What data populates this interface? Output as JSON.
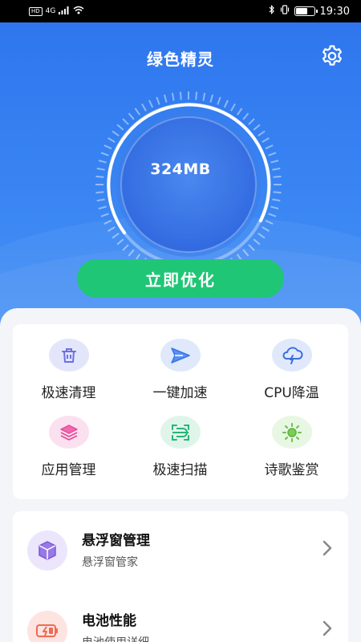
{
  "status_bar": {
    "network": "4G",
    "hd": "HD",
    "time": "19:30",
    "battery_level": 0.6
  },
  "header": {
    "title": "绿色精灵",
    "settings_icon": "gear-icon"
  },
  "gauge": {
    "value": "324MB"
  },
  "optimize_button": {
    "label": "立即优化"
  },
  "tools": [
    {
      "label": "极速清理",
      "icon": "trash-icon",
      "bg": "#e3e6fb",
      "color": "#6d6fe3"
    },
    {
      "label": "一键加速",
      "icon": "paper-plane-icon",
      "bg": "#dfe9fb",
      "color": "#3a74e8"
    },
    {
      "label": "CPU降温",
      "icon": "thunder-cloud-icon",
      "bg": "#e0e8fb",
      "color": "#3b6fdc"
    },
    {
      "label": "应用管理",
      "icon": "layers-icon",
      "bg": "#fbe0ef",
      "color": "#e34b9a"
    },
    {
      "label": "极速扫描",
      "icon": "scan-icon",
      "bg": "#dff5ea",
      "color": "#29b477"
    },
    {
      "label": "诗歌鉴赏",
      "icon": "sun-icon",
      "bg": "#e8f7e3",
      "color": "#6ac14a"
    }
  ],
  "list": [
    {
      "title": "悬浮窗管理",
      "subtitle": "悬浮窗管家",
      "icon": "box-icon",
      "bg": "#ebe6fb",
      "color": "#7b55d6"
    },
    {
      "title": "电池性能",
      "subtitle": "电池使用详细",
      "icon": "battery-icon",
      "bg": "#fde4e1",
      "color": "#ef6a55"
    }
  ],
  "colors": {
    "primary_blue": "#2f76ee",
    "accent_green": "#1fc676"
  }
}
